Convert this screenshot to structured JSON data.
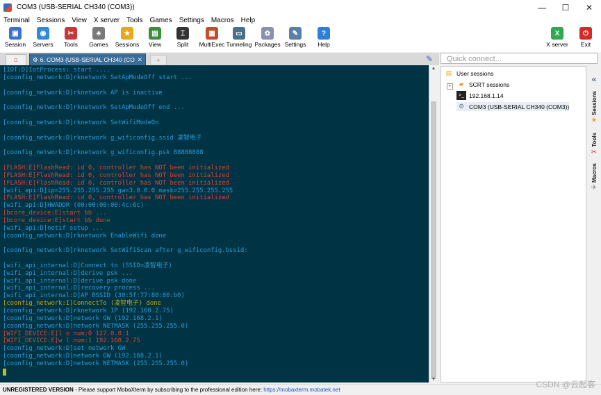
{
  "window": {
    "title": "COM3  (USB-SERIAL CH340 (COM3))",
    "minimize": "—",
    "maximize": "☐",
    "close": "✕"
  },
  "menu": [
    "Terminal",
    "Sessions",
    "View",
    "X server",
    "Tools",
    "Games",
    "Settings",
    "Macros",
    "Help"
  ],
  "toolbar": [
    {
      "label": "Session",
      "icon": "session-icon",
      "color": "#3b73c8",
      "glyph": "▣"
    },
    {
      "label": "Servers",
      "icon": "servers-icon",
      "color": "#2f8ad8",
      "glyph": "◉"
    },
    {
      "label": "Tools",
      "icon": "tools-icon",
      "color": "#c23b3b",
      "glyph": "✂"
    },
    {
      "label": "Games",
      "icon": "games-icon",
      "color": "#7a7a7a",
      "glyph": "♣"
    },
    {
      "label": "Sessions",
      "icon": "star-icon",
      "color": "#e6a817",
      "glyph": "★"
    },
    {
      "label": "View",
      "icon": "view-icon",
      "color": "#3c8e3c",
      "glyph": "▤"
    },
    {
      "label": "Split",
      "icon": "split-icon",
      "color": "#333333",
      "glyph": "⌶"
    },
    {
      "label": "MultiExec",
      "icon": "multiexec-icon",
      "color": "#c44c2a",
      "glyph": "▦"
    },
    {
      "label": "Tunneling",
      "icon": "tunneling-icon",
      "color": "#4a6f8e",
      "glyph": "▭"
    },
    {
      "label": "Packages",
      "icon": "packages-icon",
      "color": "#8b8fb0",
      "glyph": "✿"
    },
    {
      "label": "Settings",
      "icon": "settings-icon",
      "color": "#5a7fa8",
      "glyph": "✎"
    },
    {
      "label": "Help",
      "icon": "help-icon",
      "color": "#2d7fd8",
      "glyph": "?"
    }
  ],
  "toolbar_right": [
    {
      "label": "X server",
      "icon": "xserver-icon",
      "color": "#2fa84f",
      "glyph": "X"
    },
    {
      "label": "Exit",
      "icon": "exit-icon",
      "color": "#d42a2a",
      "glyph": "⏻"
    }
  ],
  "tabs": {
    "active_label": "6. COM3  (USB-SERIAL CH340 (CO",
    "close": "✕",
    "new": "+"
  },
  "terminal": {
    "lines": [
      {
        "text": "[IOT:D]IotProcess: start ....",
        "color": "blue"
      },
      {
        "text": "[coonfig_network:D]rknetwork SetApModeOff start ...",
        "color": "blue"
      },
      {
        "text": "",
        "color": "blue"
      },
      {
        "text": "[coonfig_network:D]rknetwork AP is inactive",
        "color": "blue"
      },
      {
        "text": "",
        "color": "blue"
      },
      {
        "text": "[coonfig_network:D]rknetwork SetApModeOff end ...",
        "color": "blue"
      },
      {
        "text": "",
        "color": "blue"
      },
      {
        "text": "[coonfig_network:D]rknetwork SetWifiModeOn",
        "color": "blue"
      },
      {
        "text": "",
        "color": "blue"
      },
      {
        "text": "[coonfig_network:D]rknetwork g_wificonfig.ssid 凌智电子",
        "color": "blue"
      },
      {
        "text": "",
        "color": "blue"
      },
      {
        "text": "[coonfig_network:D]rknetwork g_wificonfig.psk 88888888",
        "color": "blue"
      },
      {
        "text": "",
        "color": "blue"
      },
      {
        "text": "[FLASH:E]FlashRead: id 0, controller has NOT been initialized",
        "color": "red"
      },
      {
        "text": "[FLASH:E]FlashRead: id 0, controller has NOT been initialized",
        "color": "red"
      },
      {
        "text": "[FLASH:E]FlashRead: id 0, controller has NOT been initialized",
        "color": "red"
      },
      {
        "text": "[wifi_api:D]ip=255.255.255.255 gw=3.0.0.0 mask=255.255.255.255",
        "color": "blue"
      },
      {
        "text": "[FLASH:E]FlashRead: id 0, controller has NOT been initialized",
        "color": "red"
      },
      {
        "text": "[wifi_api:D]HWADDR (00:00:00:00:4c:6c)",
        "color": "blue"
      },
      {
        "text": "[bcore_device:E]start bb ...",
        "color": "red"
      },
      {
        "text": "[bcore_device:E]start bb done",
        "color": "red"
      },
      {
        "text": "[wifi_api:D]netif setup ...",
        "color": "blue"
      },
      {
        "text": "[coonfig_network:D]rknetwork EnableWifi done",
        "color": "blue"
      },
      {
        "text": "",
        "color": "blue"
      },
      {
        "text": "[coonfig_network:D]rknetwork SetWifiScan after g_wificonfig.bssid:",
        "color": "blue"
      },
      {
        "text": "",
        "color": "blue"
      },
      {
        "text": "[wifi_api_internal:D]Connect to (SSID=凌智电子)",
        "color": "blue"
      },
      {
        "text": "[wifi_api_internal:D]derive psk ...",
        "color": "blue"
      },
      {
        "text": "[wifi_api_internal:D]derive psk done",
        "color": "blue"
      },
      {
        "text": "[wifi_api_internal:D]recovery process ...",
        "color": "blue"
      },
      {
        "text": "[wifi_api_internal:D]AP BSSID (30:5f:77:80:80:b0)",
        "color": "blue"
      },
      {
        "text": "[coonfig_network:I]ConnectTo (凌智电子) done",
        "color": "yellow"
      },
      {
        "text": "[coonfig_network:D]rknetwork IP (192.168.2.75)",
        "color": "blue"
      },
      {
        "text": "[coonfig_network:D]network GW (192.168.2.1)",
        "color": "blue"
      },
      {
        "text": "[coonfig_network:D]network NETMASK (255.255.255.0)",
        "color": "blue"
      },
      {
        "text": "[WIFI_DEVICE:E]l o num:0 127.0.0.1",
        "color": "red"
      },
      {
        "text": "[WIFI_DEVICE:E]w l num:1 192.168.2.75",
        "color": "red"
      },
      {
        "text": "[coonfig_network:D]set network GW",
        "color": "blue"
      },
      {
        "text": "[coonfig_network:D]network GW (192.168.2.1)",
        "color": "blue"
      },
      {
        "text": "[coonfig_network:D]network NETMASK (255.255.255.0)",
        "color": "blue"
      }
    ]
  },
  "colors": {
    "terminal_bg": "#003445",
    "blue": "#2e9bd6",
    "red": "#e0412e",
    "yellow": "#c9a613",
    "tab_active": "#3a6e99"
  },
  "quick_connect": {
    "placeholder": "Quick connect..."
  },
  "sessions_tree": {
    "root": "User sessions",
    "items": [
      {
        "label": "SCRT sessions",
        "icon": "folder-icon",
        "expander": "+"
      },
      {
        "label": "192.168.1.14",
        "icon": "terminal-icon"
      },
      {
        "label": "COM3  (USB-SERIAL CH340 (COM3))",
        "icon": "serial-icon",
        "selected": true
      }
    ]
  },
  "side_tabs": [
    "Sessions",
    "Tools",
    "Macros"
  ],
  "side_collapse": "«",
  "status": {
    "unregistered": "UNREGISTERED VERSION",
    "message": "  -  Please support MobaXterm by subscribing to the professional edition here:  ",
    "link": "https://mobaxterm.mobatek.net"
  },
  "watermark": "CSDN @云起客"
}
